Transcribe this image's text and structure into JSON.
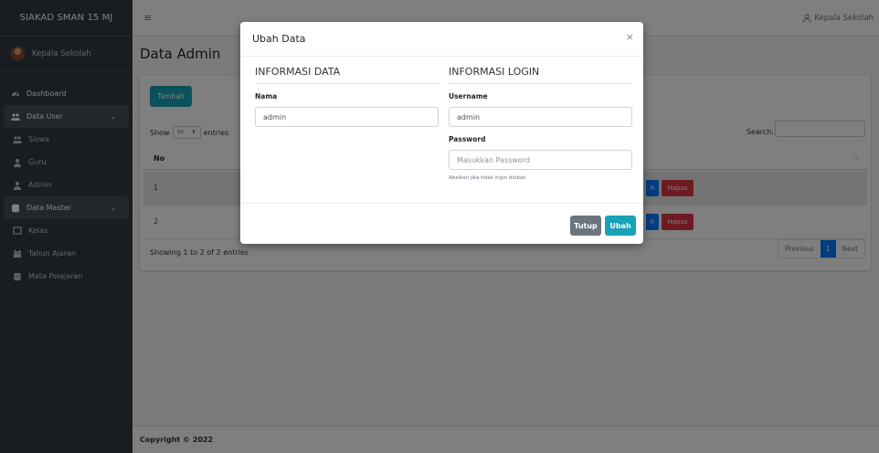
{
  "brand": "SIAKAD SMAN 15 MJ",
  "user_panel": {
    "name": "Kepala Sekolah"
  },
  "sidebar": {
    "items": [
      {
        "label": "Dashboard",
        "icon": "dashboard-icon"
      },
      {
        "label": "Data User",
        "icon": "users-icon"
      },
      {
        "label": "Siswa",
        "icon": "user-group-icon"
      },
      {
        "label": "Guru",
        "icon": "teacher-icon"
      },
      {
        "label": "Admin",
        "icon": "admin-icon"
      },
      {
        "label": "Data Master",
        "icon": "database-icon"
      },
      {
        "label": "Kelas",
        "icon": "classroom-icon"
      },
      {
        "label": "Tahun Ajaran",
        "icon": "calendar-icon"
      },
      {
        "label": "Mata Pelajaran",
        "icon": "book-icon"
      }
    ]
  },
  "topbar": {
    "menu_icon": "≡",
    "user": "Kepala Sekolah"
  },
  "page": {
    "title": "Data Admin"
  },
  "card": {
    "add_button": "Tambah",
    "show_label": "Show",
    "entries_value": "10",
    "entries_label": "entries",
    "search_label": "Search:",
    "columns": [
      "No"
    ],
    "rows": [
      {
        "no": "1",
        "edit": "h",
        "delete": "Hapus"
      },
      {
        "no": "2",
        "edit": "h",
        "delete": "Hapus"
      }
    ],
    "info": "Showing 1 to 2 of 2 entries",
    "pager": {
      "prev": "Previous",
      "current": "1",
      "next": "Next"
    }
  },
  "footer": {
    "text": "Copyright © 2022"
  },
  "modal": {
    "title": "Ubah Data",
    "close": "×",
    "left_section": "INFORMASI DATA",
    "right_section": "INFORMASI LOGIN",
    "nama_label": "Nama",
    "nama_value": "admin",
    "username_label": "Username",
    "username_value": "admin",
    "password_label": "Password",
    "password_placeholder": "Masukkan Password",
    "password_hint": "Abaikan jika tidak ingin diubah",
    "cancel_button": "Tutup",
    "submit_button": "Ubah"
  },
  "colors": {
    "sidebar": "#343a40",
    "info": "#17a2b8",
    "primary": "#007bff",
    "danger": "#dc3545",
    "secondary": "#6c757d"
  }
}
